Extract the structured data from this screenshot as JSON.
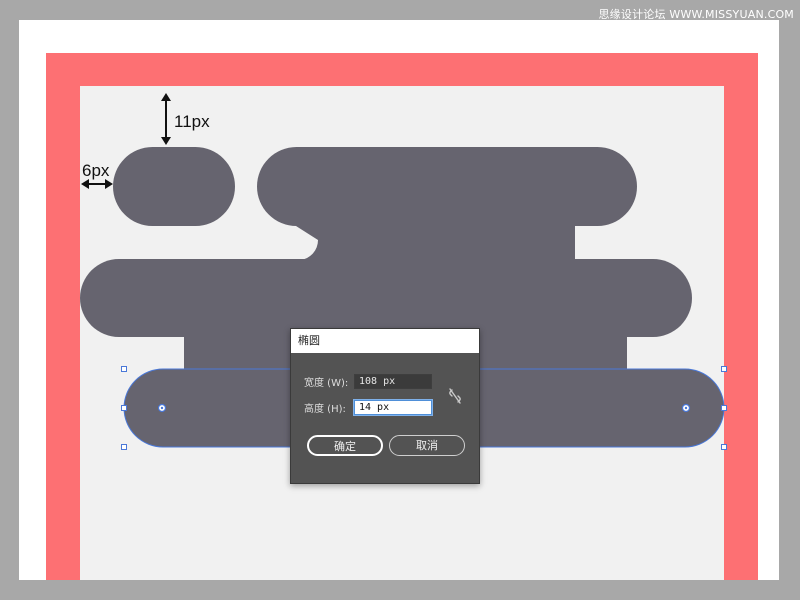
{
  "watermark": "思缘设计论坛 WWW.MISSYUAN.COM",
  "measurements": {
    "vertical_gap": "11px",
    "horizontal_gap": "6px"
  },
  "dialog": {
    "title": "椭圆",
    "width_label": "宽度 (W):",
    "width_value": "108 px",
    "height_label": "高度 (H):",
    "height_value": "14 px",
    "ok_label": "确定",
    "cancel_label": "取消"
  },
  "colors": {
    "shape_fill": "#66646f",
    "artboard_border": "#fd7073",
    "artboard_bg": "#f1f1f1",
    "selection": "#4a78d8",
    "dialog_bg": "#535353"
  },
  "icons": {
    "constrain": "chain-link-broken-icon"
  }
}
